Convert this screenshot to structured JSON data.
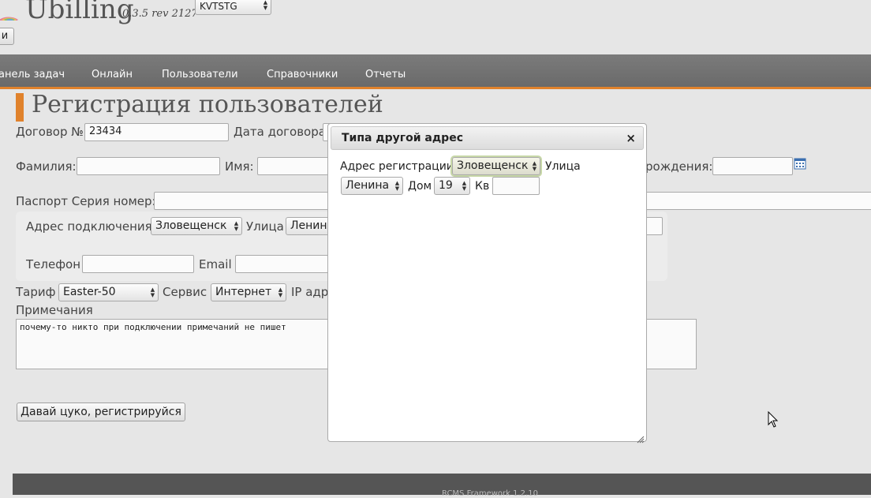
{
  "header": {
    "logo": "Ubilling",
    "version": "0.3.5 rev 2127",
    "locale_select": "KVTSTG",
    "left_button": "и"
  },
  "nav": {
    "items": [
      "анель задач",
      "Онлайн",
      "Пользователи",
      "Справочники",
      "Отчеты"
    ]
  },
  "page": {
    "title": "Регистрация пользователей",
    "contract_label": "Договор №",
    "contract_value": "23434",
    "contract_date_label": "Дата договора",
    "surname_label": "Фамилия:",
    "name_label": "Имя:",
    "birth_label": "рождения:",
    "passport_label": "Паспорт Серия номер:",
    "conn_addr_label": "Адрес подключения:",
    "conn_city": "Зловещенск",
    "street_label": "Улица",
    "conn_street": "Ленин",
    "phone_label": "Телефон",
    "email_label": "Email",
    "tariff_label": "Тариф",
    "tariff_value": "Easter-50",
    "service_label": "Сервис",
    "service_value": "Интернет",
    "ip_label": "IP адр",
    "notes_label": "Примечания",
    "notes_value": "почему-то никто при подключении примечаний не пишет",
    "register_button": "Давай цуко, регистрируйся"
  },
  "dialog": {
    "title": "Типа другой адрес",
    "close_icon": "×",
    "reg_addr_label": "Адрес регистрации:",
    "city": "Зловещенск",
    "street_label": "Улица",
    "street": "Ленина",
    "house_label": "Дом",
    "house": "19",
    "apt_label": "Кв",
    "apt": ""
  },
  "footer": {
    "text": "RCMS Framework 1.2.10"
  },
  "colors": {
    "accent": "#e0822c",
    "nav": "#707070"
  }
}
